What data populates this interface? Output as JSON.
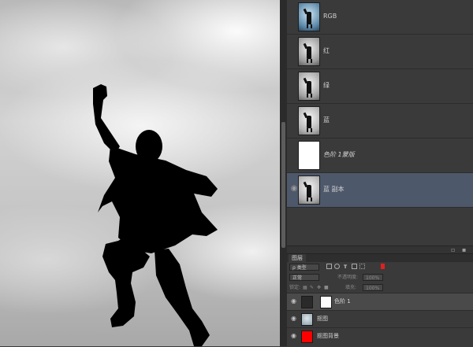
{
  "channels": [
    {
      "label": "RGB",
      "thumb": "rgb",
      "selected": false,
      "italic": false
    },
    {
      "label": "红",
      "thumb": "gray1",
      "selected": false,
      "italic": false
    },
    {
      "label": "绿",
      "thumb": "gray2",
      "selected": false,
      "italic": false
    },
    {
      "label": "蓝",
      "thumb": "gray3",
      "selected": false,
      "italic": false
    },
    {
      "label": "色阶 1蒙版",
      "thumb": "white",
      "selected": false,
      "italic": true
    },
    {
      "label": "蓝 副本",
      "thumb": "gray4",
      "selected": true,
      "italic": false
    }
  ],
  "layers_panel": {
    "tab_label": "图层",
    "filter_kind": "ρ 类型",
    "blend_mode": "正常",
    "opacity_label": "不透明度:",
    "opacity_value": "100%",
    "lock_label": "锁定:",
    "fill_label": "填充:",
    "fill_value": "100%",
    "layers": [
      {
        "name": "色阶 1",
        "type": "adjustment",
        "active": true
      },
      {
        "name": "抠图",
        "type": "photo",
        "active": false
      },
      {
        "name": "抠图背景",
        "type": "red-fill",
        "active": false
      }
    ]
  },
  "colors": {
    "selected_row": "#4e586b",
    "panel_bg": "#3a3a3a",
    "red_swatch": "#ff0000"
  },
  "icons": {
    "eye": "eye-icon",
    "filter_image": "image-filter-icon",
    "filter_adjust": "adjustment-filter-icon",
    "filter_type": "type-filter-icon",
    "filter_shape": "shape-filter-icon",
    "filter_smart": "smart-object-filter-icon",
    "filter_toggle": "filter-toggle-icon"
  }
}
